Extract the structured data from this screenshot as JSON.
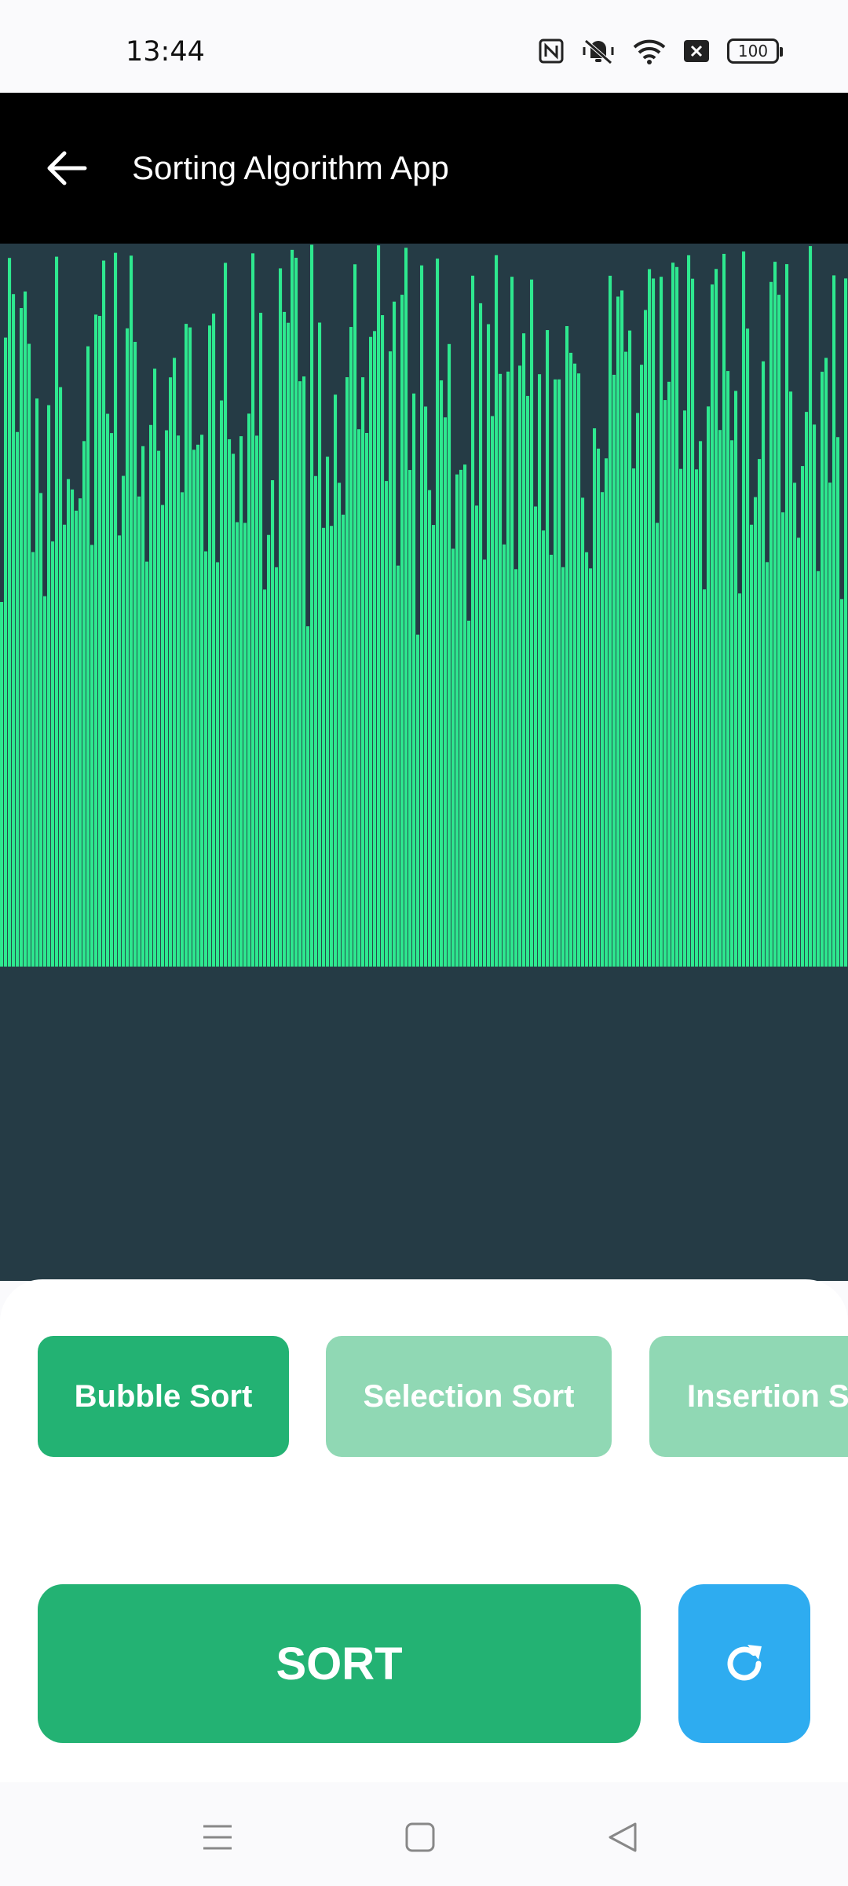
{
  "status_bar": {
    "time": "13:44",
    "icons": [
      "nfc-icon",
      "vibrate-mute-icon",
      "wifi-icon",
      "sim-off-icon"
    ],
    "battery": "100"
  },
  "app_bar": {
    "title": "Sorting Algorithm App",
    "back_icon": "arrow-left-icon"
  },
  "visualizer": {
    "bar_color": "#2ee88f",
    "background_color": "#253b45"
  },
  "algorithms": [
    {
      "label": "Bubble Sort",
      "selected": true
    },
    {
      "label": "Selection Sort",
      "selected": false
    },
    {
      "label": "Insertion Sort",
      "visible_label": "Insertion S",
      "selected": false
    }
  ],
  "actions": {
    "sort_label": "SORT",
    "reset_icon": "refresh-icon",
    "sort_color": "#23b273",
    "reset_color": "#2eacf0"
  },
  "nav_bar": {
    "icons": [
      "menu-icon",
      "home-icon",
      "back-triangle-icon"
    ]
  }
}
